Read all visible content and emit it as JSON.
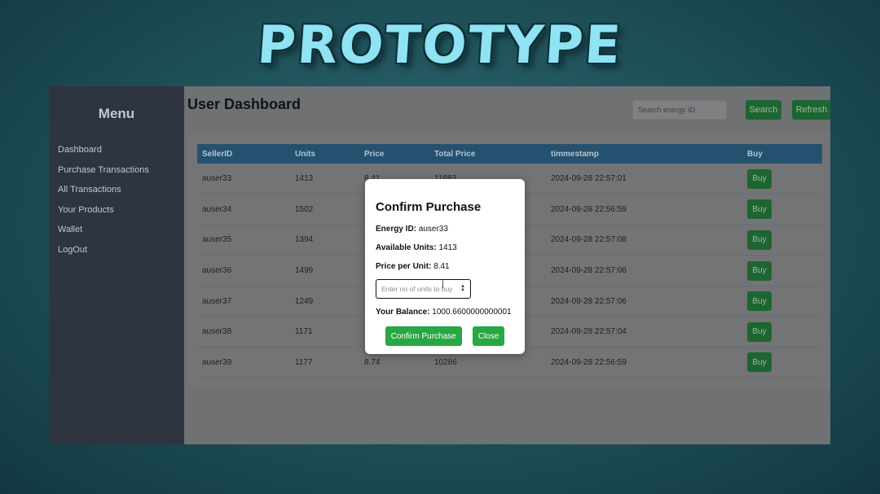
{
  "banner": {
    "text": "PROTOTYPE"
  },
  "sidebar": {
    "title": "Menu",
    "items": [
      {
        "label": "Dashboard"
      },
      {
        "label": "Purchase Transactions"
      },
      {
        "label": "All Transactions"
      },
      {
        "label": "Your Products"
      },
      {
        "label": "Wallet"
      },
      {
        "label": "LogOut"
      }
    ]
  },
  "header": {
    "title": "User Dashboard",
    "search_placeholder": "Search energy ID",
    "search_label": "Search",
    "refresh_label": "Refresh"
  },
  "table": {
    "columns": [
      "SellerID",
      "Units",
      "Price",
      "Total Price",
      "timmestamp",
      "Buy"
    ],
    "rows": [
      {
        "seller": "auser33",
        "units": "1413",
        "price": "8.41",
        "total": "11883",
        "timestamp": "2024-09-28 22:57:01",
        "buy": "Buy"
      },
      {
        "seller": "auser34",
        "units": "1502",
        "price": "",
        "total": "",
        "timestamp": "2024-09-28 22:56:59",
        "buy": "Buy"
      },
      {
        "seller": "auser35",
        "units": "1394",
        "price": "",
        "total": "",
        "timestamp": "2024-09-28 22:57:08",
        "buy": "Buy"
      },
      {
        "seller": "auser36",
        "units": "1499",
        "price": "",
        "total": "",
        "timestamp": "2024-09-28 22:57:06",
        "buy": "Buy"
      },
      {
        "seller": "auser37",
        "units": "1249",
        "price": "",
        "total": "",
        "timestamp": "2024-09-28 22:57:06",
        "buy": "Buy"
      },
      {
        "seller": "auser38",
        "units": "1171",
        "price": "",
        "total": "",
        "timestamp": "2024-09-28 22:57:04",
        "buy": "Buy"
      },
      {
        "seller": "auser39",
        "units": "1177",
        "price": "8.74",
        "total": "10286",
        "timestamp": "2024-09-28 22:56:59",
        "buy": "Buy"
      }
    ]
  },
  "modal": {
    "title": "Confirm Purchase",
    "energy_id_label": "Energy ID:",
    "energy_id_value": "auser33",
    "available_label": "Available Units:",
    "available_value": "1413",
    "price_label": "Price per Unit:",
    "price_value": "8.41",
    "qty_placeholder": "Enter no of units to buy",
    "balance_label": "Your Balance:",
    "balance_value": "1000.6600000000001",
    "confirm_label": "Confirm Purchase",
    "close_label": "Close"
  },
  "colors": {
    "sidebar_bg": "#2e3440",
    "table_header": "#24516f",
    "button_green": "#28a745",
    "overlay_main": "#6f7173"
  }
}
